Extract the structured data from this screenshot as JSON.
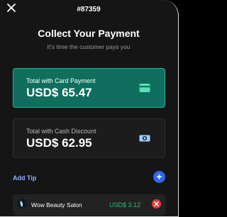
{
  "header": {
    "close_icon": "close-icon",
    "order_number": "#87359"
  },
  "payment": {
    "title": "Collect Your Payment",
    "subtitle": "It's time the customer pays you"
  },
  "options": [
    {
      "label": "Total with Card Payment",
      "value": "USD$ 65.47",
      "icon": "credit-card-icon",
      "selected": true,
      "color": "#0f6e5d"
    },
    {
      "label": "Total with Cash Discount",
      "value": "USD$ 62.95",
      "icon": "cash-icon",
      "selected": false,
      "color": "#1c1c1c"
    }
  ],
  "tip": {
    "add_label": "Add Tip",
    "add_icon": "plus-icon",
    "items": [
      {
        "name": "Wow Beauty Salon",
        "amount": "USD$ 3.12",
        "remove_icon": "remove-icon"
      }
    ]
  },
  "colors": {
    "accent_green": "#21c07a",
    "accent_blue": "#2f68e8",
    "remove_red": "#e23b3b"
  }
}
